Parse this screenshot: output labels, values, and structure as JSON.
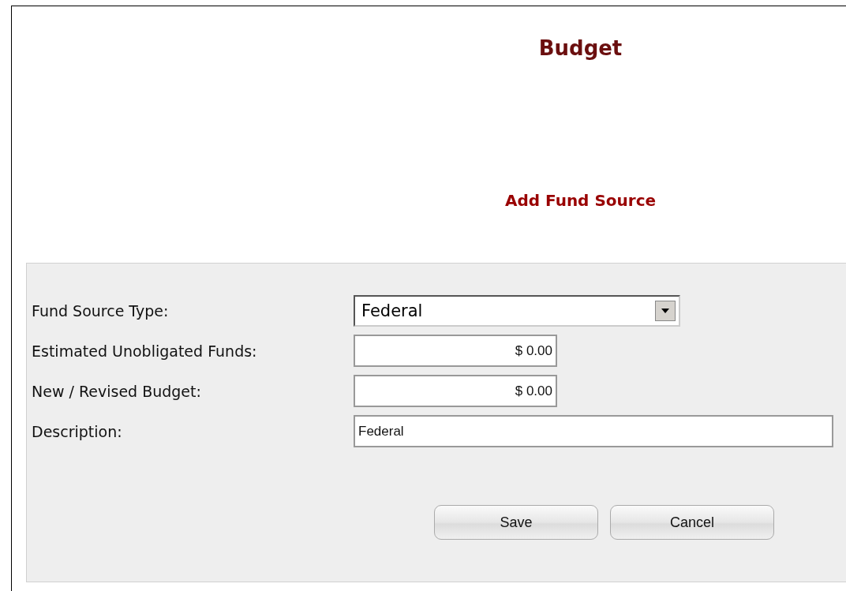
{
  "page_title": "Budget",
  "form": {
    "title": "Add Fund Source",
    "fields": [
      {
        "label": "Fund Source Type:",
        "kind": "select",
        "value": "Federal"
      },
      {
        "label": "Estimated Unobligated Funds:",
        "kind": "amount",
        "value": "$ 0.00"
      },
      {
        "label": "New / Revised Budget:",
        "kind": "amount",
        "value": "$ 0.00"
      },
      {
        "label": "Description:",
        "kind": "text",
        "value": "Federal"
      }
    ],
    "buttons": [
      "Save",
      "Cancel"
    ]
  }
}
